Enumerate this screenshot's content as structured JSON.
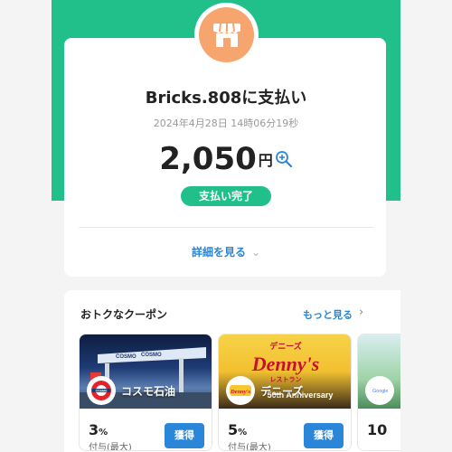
{
  "payment": {
    "merchant_title": "Bricks.808に支払い",
    "datetime": "2024年4月28日 14時06分19秒",
    "amount": "2,050",
    "currency": "円",
    "status": "支払い完了",
    "details_link": "詳細を見る",
    "store_icon": "store-icon",
    "zoom_icon": "zoom-in-icon"
  },
  "coupons": {
    "title": "おトクなクーポン",
    "more_link": "もっと見る",
    "items": [
      {
        "name": "コスモ石油",
        "logo_text": "COSMO",
        "percent": "3",
        "unit": "%",
        "note": "付与(最大)",
        "button": "獲得",
        "banner_text": "COSMO"
      },
      {
        "name": "デニーズ",
        "logo_text": "Denny's",
        "percent": "5",
        "unit": "%",
        "note": "付与(最大)",
        "button": "獲得",
        "banner_top": "デニーズ",
        "banner_main": "Denny's",
        "banner_sub": "レストラン",
        "banner_small": "50th Anniversary"
      },
      {
        "percent": "10",
        "logo_text": "Google"
      }
    ]
  },
  "colors": {
    "brand_green": "#21c08a",
    "link_blue": "#2a86d8",
    "store_orange": "#f5a56d"
  }
}
